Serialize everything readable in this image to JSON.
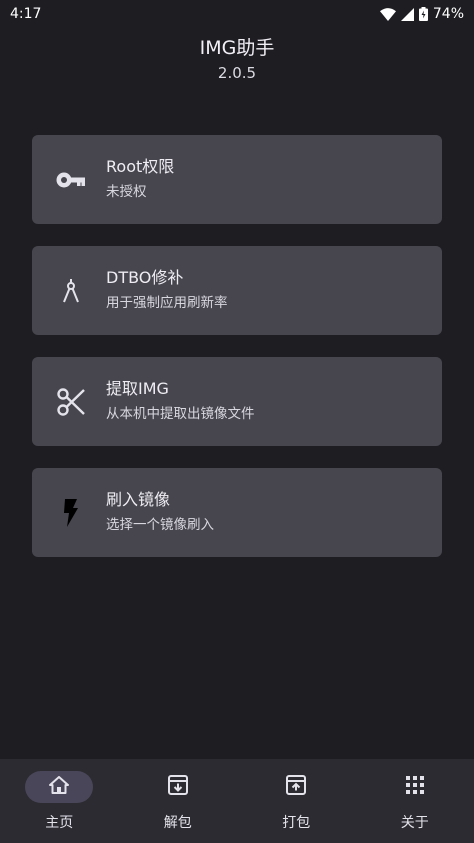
{
  "status_bar": {
    "time": "4:17",
    "battery": "74%"
  },
  "header": {
    "title": "IMG助手",
    "version": "2.0.5"
  },
  "cards": [
    {
      "title": "Root权限",
      "subtitle": "未授权",
      "icon": "key-icon"
    },
    {
      "title": "DTBO修补",
      "subtitle": "用于强制应用刷新率",
      "icon": "compass-icon"
    },
    {
      "title": "提取IMG",
      "subtitle": "从本机中提取出镜像文件",
      "icon": "scissors-icon"
    },
    {
      "title": "刷入镜像",
      "subtitle": "选择一个镜像刷入",
      "icon": "flash-icon"
    }
  ],
  "bottom_nav": [
    {
      "label": "主页",
      "icon": "home-icon",
      "active": true
    },
    {
      "label": "解包",
      "icon": "unarchive-icon",
      "active": false
    },
    {
      "label": "打包",
      "icon": "archive-icon",
      "active": false
    },
    {
      "label": "关于",
      "icon": "apps-grid-icon",
      "active": false
    }
  ],
  "colors": {
    "background": "#1e1d22",
    "card": "#47454e",
    "nav_background": "#2c2b31",
    "nav_active_pill": "#4a4659"
  }
}
